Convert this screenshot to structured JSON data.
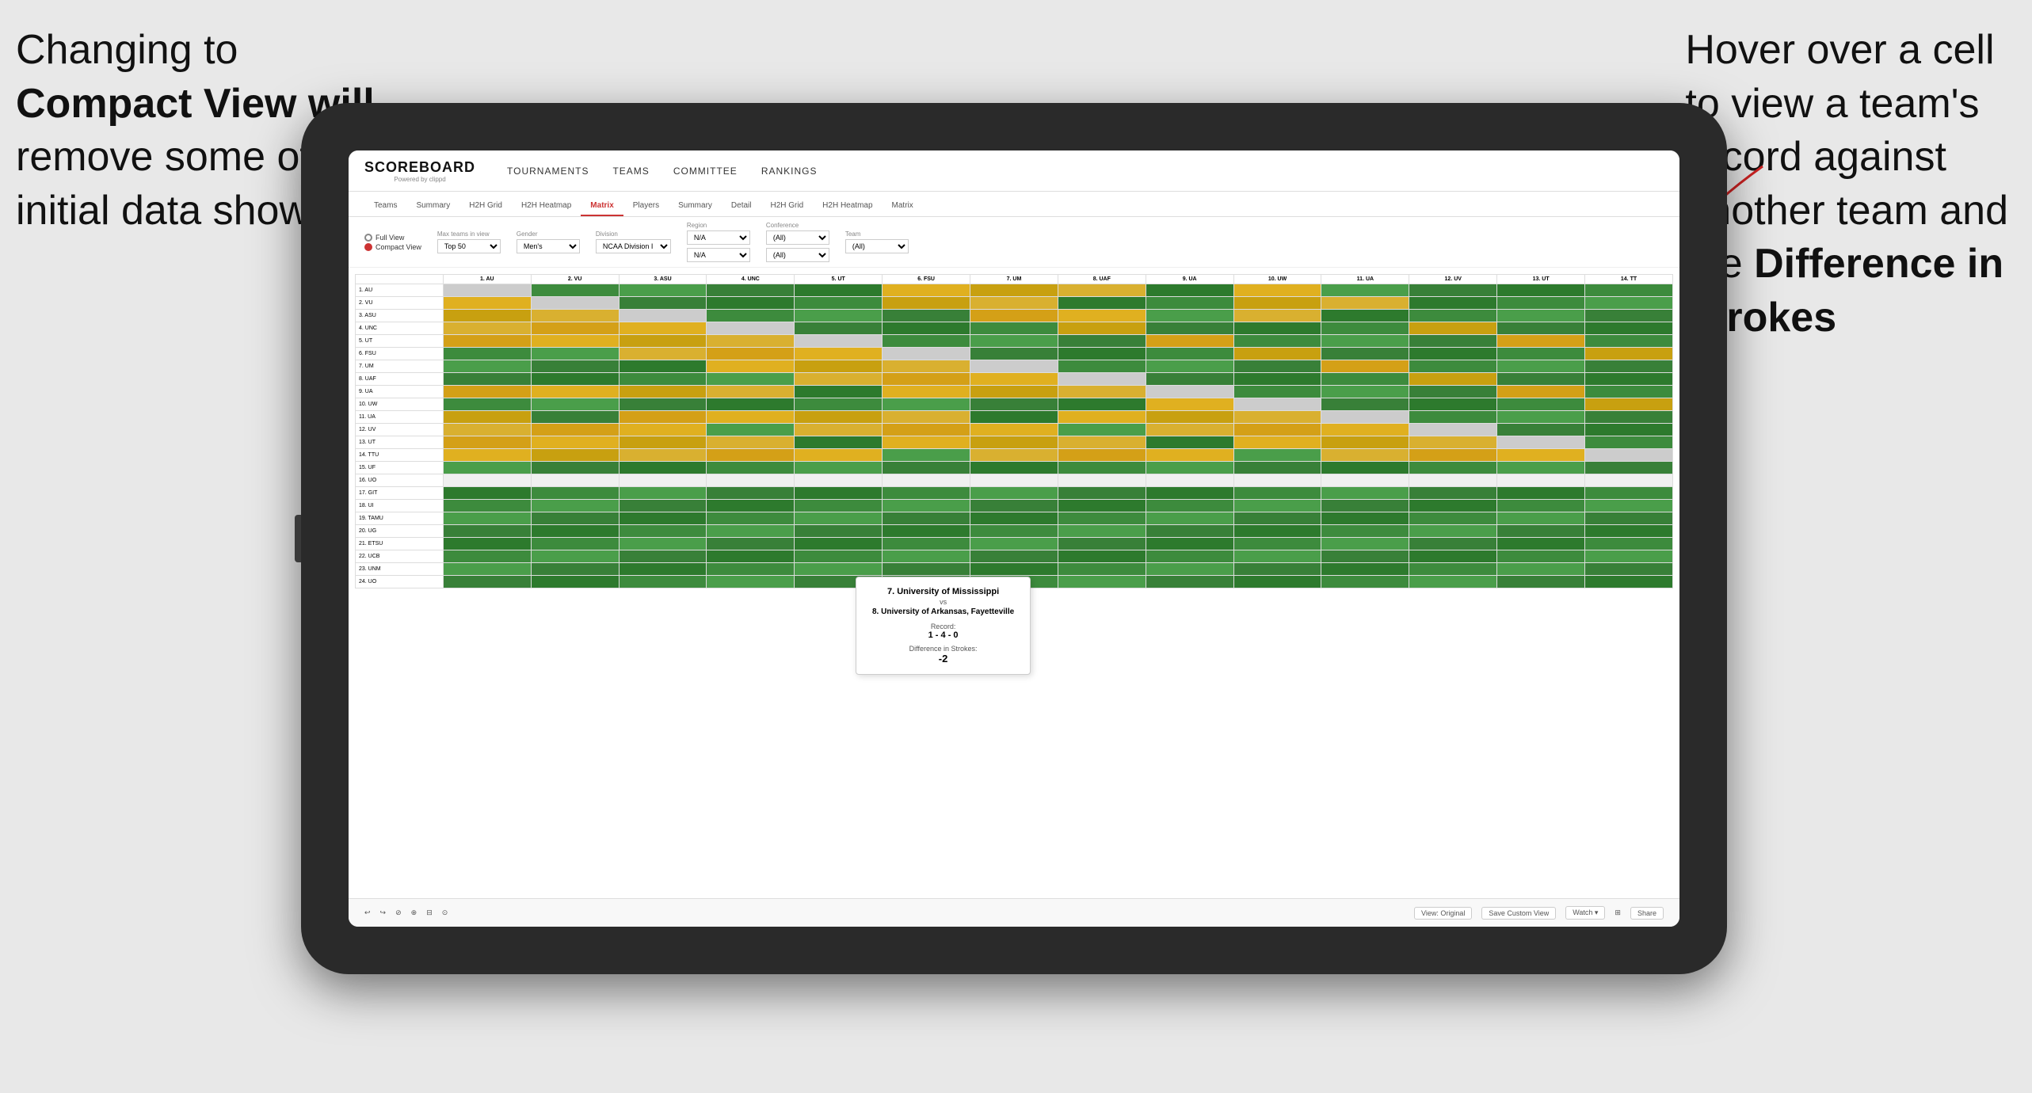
{
  "annotations": {
    "left_text_line1": "Changing to",
    "left_text_line2": "Compact View",
    "left_text_line3": " will",
    "left_text_line4": "remove some of the",
    "left_text_line5": "initial data shown",
    "right_text_line1": "Hover over a cell",
    "right_text_line2": "to view a team's",
    "right_text_line3": "record against",
    "right_text_line4": "another team and",
    "right_text_line5": "the ",
    "right_text_bold": "Difference in",
    "right_text_line6": "Strokes"
  },
  "app": {
    "logo": "SCOREBOARD",
    "logo_sub": "Powered by clippd",
    "nav": [
      "TOURNAMENTS",
      "TEAMS",
      "COMMITTEE",
      "RANKINGS"
    ]
  },
  "sub_nav": {
    "items": [
      "Teams",
      "Summary",
      "H2H Grid",
      "H2H Heatmap",
      "Matrix",
      "Players",
      "Summary",
      "Detail",
      "H2H Grid",
      "H2H Heatmap",
      "Matrix"
    ],
    "active": "Matrix"
  },
  "controls": {
    "view_options": [
      "Full View",
      "Compact View"
    ],
    "selected_view": "Compact View",
    "filters": {
      "max_teams": {
        "label": "Max teams in view",
        "value": "Top 50"
      },
      "gender": {
        "label": "Gender",
        "value": "Men's"
      },
      "division": {
        "label": "Division",
        "value": "NCAA Division I"
      },
      "region": {
        "label": "Region",
        "value": "N/A"
      },
      "conference": {
        "label": "Conference",
        "value": "(All)"
      },
      "team": {
        "label": "Team",
        "value": "(All)"
      }
    }
  },
  "matrix": {
    "col_headers": [
      "1. AU",
      "2. VU",
      "3. ASU",
      "4. UNC",
      "5. UT",
      "6. FSU",
      "7. UM",
      "8. UAF",
      "9. UA",
      "10. UW",
      "11. UA",
      "12. UV",
      "13. UT",
      "14. TT"
    ],
    "rows": [
      {
        "label": "1. AU",
        "cells": [
          "self",
          "g",
          "g",
          "g",
          "g",
          "y",
          "y",
          "y",
          "g",
          "y",
          "g",
          "g",
          "g",
          "g"
        ]
      },
      {
        "label": "2. VU",
        "cells": [
          "y",
          "self",
          "g",
          "g",
          "g",
          "y",
          "y",
          "g",
          "g",
          "y",
          "y",
          "g",
          "g",
          "g"
        ]
      },
      {
        "label": "3. ASU",
        "cells": [
          "y",
          "y",
          "self",
          "g",
          "g",
          "g",
          "y",
          "y",
          "g",
          "y",
          "g",
          "g",
          "g",
          "g"
        ]
      },
      {
        "label": "4. UNC",
        "cells": [
          "y",
          "y",
          "y",
          "self",
          "g",
          "g",
          "g",
          "y",
          "g",
          "g",
          "g",
          "y",
          "g",
          "g"
        ]
      },
      {
        "label": "5. UT",
        "cells": [
          "y",
          "y",
          "y",
          "y",
          "self",
          "g",
          "g",
          "g",
          "y",
          "g",
          "g",
          "g",
          "y",
          "g"
        ]
      },
      {
        "label": "6. FSU",
        "cells": [
          "g",
          "g",
          "y",
          "y",
          "y",
          "self",
          "g",
          "g",
          "g",
          "y",
          "g",
          "g",
          "g",
          "y"
        ]
      },
      {
        "label": "7. UM",
        "cells": [
          "g",
          "g",
          "g",
          "y",
          "y",
          "y",
          "self",
          "g",
          "g",
          "g",
          "y",
          "g",
          "g",
          "g"
        ]
      },
      {
        "label": "8. UAF",
        "cells": [
          "g",
          "g",
          "g",
          "g",
          "y",
          "y",
          "y",
          "self",
          "g",
          "g",
          "g",
          "y",
          "g",
          "g"
        ]
      },
      {
        "label": "9. UA",
        "cells": [
          "y",
          "y",
          "y",
          "y",
          "g",
          "y",
          "y",
          "y",
          "self",
          "g",
          "g",
          "g",
          "y",
          "g"
        ]
      },
      {
        "label": "10. UW",
        "cells": [
          "g",
          "g",
          "g",
          "g",
          "g",
          "g",
          "g",
          "g",
          "y",
          "self",
          "g",
          "g",
          "g",
          "y"
        ]
      },
      {
        "label": "11. UA",
        "cells": [
          "y",
          "g",
          "y",
          "y",
          "y",
          "y",
          "g",
          "y",
          "y",
          "y",
          "self",
          "g",
          "g",
          "g"
        ]
      },
      {
        "label": "12. UV",
        "cells": [
          "y",
          "y",
          "y",
          "g",
          "y",
          "y",
          "y",
          "g",
          "y",
          "y",
          "y",
          "self",
          "g",
          "g"
        ]
      },
      {
        "label": "13. UT",
        "cells": [
          "y",
          "y",
          "y",
          "y",
          "g",
          "y",
          "y",
          "y",
          "g",
          "y",
          "y",
          "y",
          "self",
          "g"
        ]
      },
      {
        "label": "14. TTU",
        "cells": [
          "y",
          "y",
          "y",
          "y",
          "y",
          "g",
          "y",
          "y",
          "y",
          "g",
          "y",
          "y",
          "y",
          "self"
        ]
      },
      {
        "label": "15. UF",
        "cells": [
          "g",
          "g",
          "g",
          "g",
          "g",
          "g",
          "g",
          "g",
          "g",
          "g",
          "g",
          "g",
          "g",
          "g"
        ]
      },
      {
        "label": "16. UO",
        "cells": [
          "w",
          "w",
          "w",
          "w",
          "w",
          "w",
          "w",
          "w",
          "w",
          "w",
          "w",
          "w",
          "w",
          "w"
        ]
      },
      {
        "label": "17. GIT",
        "cells": [
          "g",
          "g",
          "g",
          "g",
          "g",
          "g",
          "g",
          "g",
          "g",
          "g",
          "g",
          "g",
          "g",
          "g"
        ]
      },
      {
        "label": "18. UI",
        "cells": [
          "g",
          "g",
          "g",
          "g",
          "g",
          "g",
          "g",
          "g",
          "g",
          "g",
          "g",
          "g",
          "g",
          "g"
        ]
      },
      {
        "label": "19. TAMU",
        "cells": [
          "g",
          "g",
          "g",
          "g",
          "g",
          "g",
          "g",
          "g",
          "g",
          "g",
          "g",
          "g",
          "g",
          "g"
        ]
      },
      {
        "label": "20. UG",
        "cells": [
          "g",
          "g",
          "g",
          "g",
          "g",
          "g",
          "g",
          "g",
          "g",
          "g",
          "g",
          "g",
          "g",
          "g"
        ]
      },
      {
        "label": "21. ETSU",
        "cells": [
          "g",
          "g",
          "g",
          "g",
          "g",
          "g",
          "g",
          "g",
          "g",
          "g",
          "g",
          "g",
          "g",
          "g"
        ]
      },
      {
        "label": "22. UCB",
        "cells": [
          "g",
          "g",
          "g",
          "g",
          "g",
          "g",
          "g",
          "g",
          "g",
          "g",
          "g",
          "g",
          "g",
          "g"
        ]
      },
      {
        "label": "23. UNM",
        "cells": [
          "g",
          "g",
          "g",
          "g",
          "g",
          "g",
          "g",
          "g",
          "g",
          "g",
          "g",
          "g",
          "g",
          "g"
        ]
      },
      {
        "label": "24. UO",
        "cells": [
          "g",
          "g",
          "g",
          "g",
          "g",
          "g",
          "g",
          "g",
          "g",
          "g",
          "g",
          "g",
          "g",
          "g"
        ]
      }
    ]
  },
  "tooltip": {
    "team1": "7. University of Mississippi",
    "vs": "vs",
    "team2": "8. University of Arkansas, Fayetteville",
    "record_label": "Record:",
    "record": "1 - 4 - 0",
    "diff_label": "Difference in Strokes:",
    "diff": "-2"
  },
  "bottom_toolbar": {
    "buttons": [
      "↩",
      "↪",
      "⊘",
      "⊕",
      "⊟",
      "⊙"
    ],
    "view_label": "View: Original",
    "save_label": "Save Custom View",
    "watch_label": "Watch ▾",
    "share_label": "Share"
  }
}
